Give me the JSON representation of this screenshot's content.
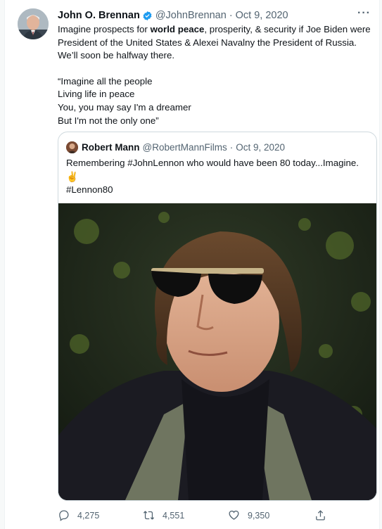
{
  "tweet": {
    "author_name": "John O. Brennan",
    "author_handle": "@JohnBrennan",
    "separator": "·",
    "date": "Oct 9, 2020",
    "more_label": "···",
    "text_lines": [
      [
        "Imagine prospects for ",
        "world peace",
        ", prosperity, & security if Joe Biden were"
      ],
      "President of the United States & Alexei Navalny the President of Russia.",
      "We’ll soon be halfway there.",
      "“Imagine all the people",
      "Living life in peace",
      "You, you may say I'm a dreamer",
      "But I'm not the only one”"
    ]
  },
  "quoted": {
    "author_name": "Robert Mann",
    "author_handle": "@RobertMannFilms",
    "separator": "·",
    "date": "Oct 9, 2020",
    "text": "Remembering #JohnLennon who would have been 80 today...Imagine.",
    "emoji": "✌",
    "hashtag": "#Lennon80"
  },
  "actions": {
    "replies": "4,275",
    "retweets": "4,551",
    "likes": "9,350"
  },
  "colors": {
    "verified": "#1d9bf0",
    "secondary_text": "#536471",
    "border": "#cfd9de"
  },
  "icons": [
    "verified-badge-icon",
    "more-icon",
    "reply-icon",
    "retweet-icon",
    "like-icon",
    "share-icon"
  ]
}
